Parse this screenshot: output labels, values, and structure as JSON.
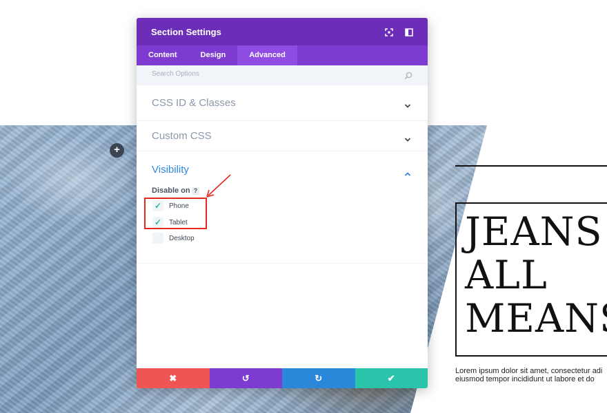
{
  "modal": {
    "title": "Section Settings",
    "tabs": [
      {
        "label": "Content",
        "active": false
      },
      {
        "label": "Design",
        "active": false
      },
      {
        "label": "Advanced",
        "active": true
      }
    ],
    "search_placeholder": "Search Options",
    "sections": {
      "css_id": "CSS ID & Classes",
      "custom_css": "Custom CSS",
      "visibility": "Visibility"
    },
    "visibility": {
      "disable_on_label": "Disable on",
      "help": "?",
      "options": [
        {
          "label": "Phone",
          "checked": true
        },
        {
          "label": "Tablet",
          "checked": true
        },
        {
          "label": "Desktop",
          "checked": false
        }
      ]
    },
    "footer": {
      "cancel": "✖",
      "undo": "↺",
      "redo": "↻",
      "save": "✔"
    }
  },
  "page": {
    "add_button": "+",
    "hero_title": "JEANS\nALL\nMEANS",
    "hero_body": [
      "Lorem ipsum dolor sit amet, consectetur adi",
      "eiusmod tempor incididunt ut labore et do"
    ]
  },
  "colors": {
    "header": "#6c2eb9",
    "tabs": "#7e3bd0",
    "accent_blue": "#2e88e0",
    "check": "#2bb7a6",
    "highlight": "#e6271f",
    "cancel": "#ef5555",
    "undo": "#7d3bd0",
    "redo": "#2b87da",
    "save": "#29c4a9"
  },
  "icons": {
    "header": [
      "fullscreen-icon",
      "sidebar-toggle-icon"
    ],
    "search": "search-icon",
    "chevron": "chevron-icon",
    "check": "check-icon"
  }
}
